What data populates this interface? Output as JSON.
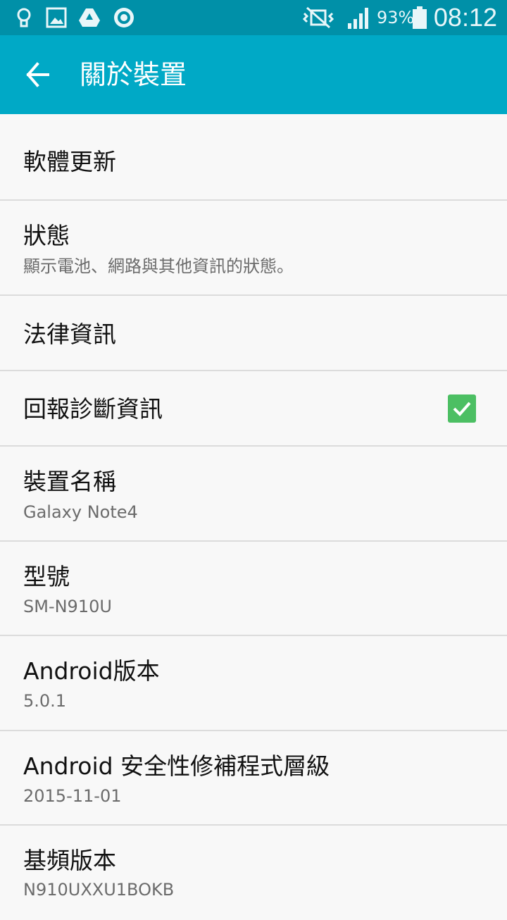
{
  "statusbar": {
    "battery_percent": "93%",
    "time": "08:12",
    "left_icons": [
      "lightbulb-icon",
      "gallery-icon",
      "drive-icon",
      "circle-app-icon"
    ],
    "right_icons": [
      "vibrate-mute-icon",
      "signal-icon",
      "battery-icon"
    ]
  },
  "appbar": {
    "title": "關於裝置",
    "back_icon": "arrow-left-icon"
  },
  "items": [
    {
      "title": "軟體更新",
      "subtitle": ""
    },
    {
      "title": "狀態",
      "subtitle": "顯示電池、網路與其他資訊的狀態。"
    },
    {
      "title": "法律資訊",
      "subtitle": ""
    },
    {
      "title": "回報診斷資訊",
      "subtitle": "",
      "checked": true
    },
    {
      "title": "裝置名稱",
      "subtitle": "Galaxy Note4"
    },
    {
      "title": "型號",
      "subtitle": "SM-N910U"
    },
    {
      "title": "Android版本",
      "subtitle": "5.0.1"
    },
    {
      "title": "Android 安全性修補程式層級",
      "subtitle": "2015-11-01"
    },
    {
      "title": "基頻版本",
      "subtitle": "N910UXXU1BOKB"
    }
  ],
  "colors": {
    "statusbar_bg": "#0090a8",
    "appbar_bg": "#00a9c6",
    "checkbox": "#4cbf63",
    "divider": "#dcdcdc"
  }
}
